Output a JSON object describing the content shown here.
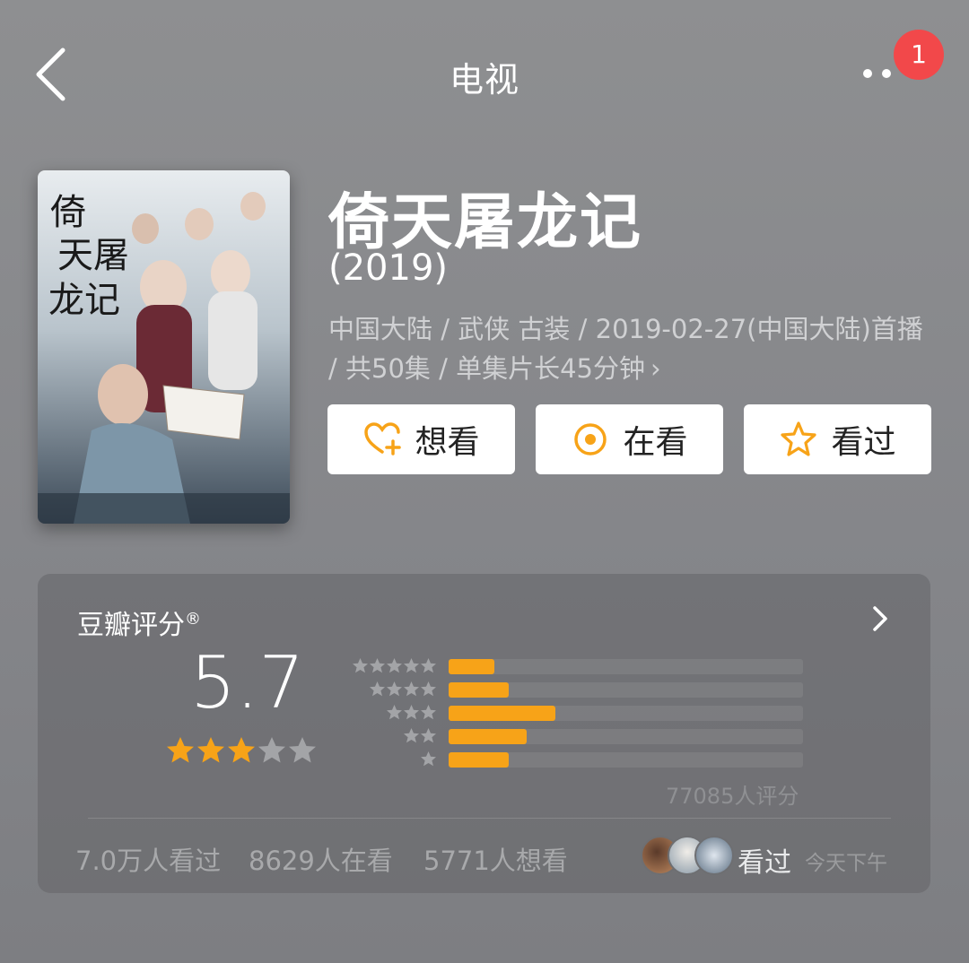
{
  "header": {
    "title": "电视",
    "badge_count": "1"
  },
  "movie": {
    "title": "倚天屠龙记",
    "year": "(2019)",
    "meta_line": "中国大陆 / 武侠 古装 / 2019-02-27(中国大陆)首播 / 共50集 / 单集片长45分钟",
    "poster_text": "倚天屠龙记"
  },
  "actions": [
    {
      "label": "想看",
      "icon": "heart-plus-icon"
    },
    {
      "label": "在看",
      "icon": "target-circle-icon"
    },
    {
      "label": "看过",
      "icon": "star-outline-icon"
    }
  ],
  "rating": {
    "title": "豆瓣评分",
    "reg_mark": "®",
    "score": "5.7",
    "stars_filled": 3,
    "stars_total": 5,
    "distribution": [
      {
        "stars": 5,
        "fraction": 0.13
      },
      {
        "stars": 4,
        "fraction": 0.17
      },
      {
        "stars": 3,
        "fraction": 0.3
      },
      {
        "stars": 2,
        "fraction": 0.22
      },
      {
        "stars": 1,
        "fraction": 0.17
      }
    ],
    "count_label": "77085人评分",
    "stats": [
      "7.0万人看过",
      "8629人在看",
      "5771人想看"
    ],
    "friends_label": "看过",
    "friends_time": "今天下午"
  },
  "colors": {
    "accent": "#f7a318",
    "badge": "#f2484a"
  }
}
